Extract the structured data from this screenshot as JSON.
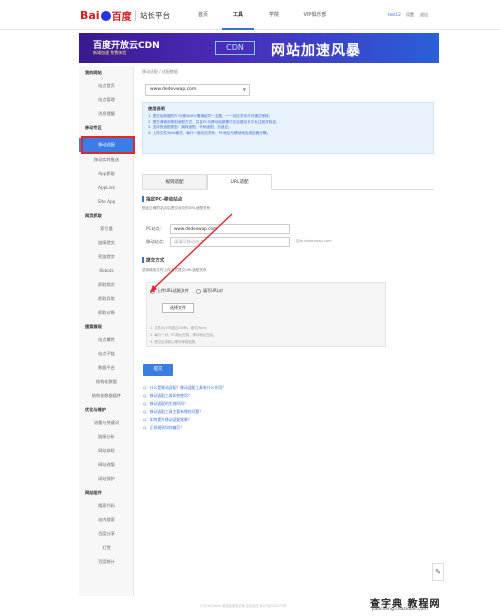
{
  "header": {
    "logo_bai": "Bai",
    "logo_du": "百度",
    "site_name": "站长平台",
    "nav": [
      "首页",
      "工具",
      "学院",
      "VIP俱乐部"
    ],
    "active_nav": "工具",
    "user_name": "test12",
    "settings": "设置",
    "logout": "退出"
  },
  "banner": {
    "title": "百度开放云CDN",
    "subtitle": "新域加速  免费体验",
    "badge": "CDN",
    "headline": "网站加速风暴"
  },
  "sidebar": {
    "groups": [
      {
        "title": "我的网站",
        "items": [
          "站点首页",
          "站点管理",
          "消息提醒"
        ]
      },
      {
        "title": "移动专区",
        "items": [
          "移动适配",
          "移动实时推送",
          "App抓取",
          "AppLink",
          "Site App"
        ]
      },
      {
        "title": "网页抓取",
        "items": [
          "索引量",
          "链接提交",
          "死链提交",
          "Robots",
          "抓取频次",
          "抓取异常",
          "抓取诊断"
        ]
      },
      {
        "title": "搜索展现",
        "items": [
          "站点属性",
          "站点子链",
          "数据平台",
          "结构化数据",
          "结构化数据插件"
        ]
      },
      {
        "title": "优化与维护",
        "items": [
          "流量与关键词",
          "链接分析",
          "网站体检",
          "网站改版",
          "闭站保护"
        ]
      },
      {
        "title": "网站组件",
        "items": [
          "搜索代码",
          "站内搜索",
          "百度分享",
          "打赏",
          "百度统计"
        ]
      }
    ],
    "active_item": "移动适配"
  },
  "main": {
    "breadcrumb": "移动适配 / 适配数据",
    "domain": "www.dedevwap.com",
    "notice": {
      "title": "使用说明",
      "lines": [
        "1. 提交后新增的PC与移动URL需满足同一主题，一一对应关系才可通过审核；",
        "2. 提交请使用规则适配方式，并且PC与移动站都需已在百度站长平台注册并验证；",
        "3. 支持的适配类型：跳转适配、代码适配、自适应；",
        "4. 上传文件为txt格式，每行一组对应关系，PC地址与移动地址用空格分隔；"
      ]
    },
    "tabs": [
      "规则适配",
      "URL适配"
    ],
    "active_tab": "URL适配",
    "section1_title": "指定PC-移动站点",
    "section1_desc": "指定正确的站点后提交对应的URL适配关系",
    "pc_label": "PC站点：",
    "pc_value": "www.dedevwap.com",
    "mobile_label": "移动站点：",
    "mobile_placeholder": "请填写移动站点",
    "mobile_hint": "如m.dedevwap.com",
    "section2_title": "提交方式",
    "section2_desc": "选择使用文件上传方式提交URL适配关系",
    "radio_upload": "上传URL适配文件",
    "radio_manual": "填写URL对",
    "file_button": "选择文件",
    "notes": [
      "1. 文件大小不超过10MB，格式为txt；",
      "2. 每行一对，PC地址在前，移动地址在后；",
      "3. 提交后请耐心等待审核结果。"
    ],
    "submit": "提交",
    "faq": [
      "Q：什么是移动适配？移动适配工具有什么作用？",
      "Q：移动适配工具如何使用？",
      "Q：移动适配的生效时间？",
      "Q：移动适配工具主要有哪些问题？",
      "Q：如何提升移动适配效果？",
      "Q：正则规则如何编写？"
    ]
  },
  "footer": "©2016 Baidu 使用百度前必读 意见反馈 京ICP证030173号",
  "watermark": {
    "main": "查字典 教程网",
    "sub": "jiaocheng.chazidian.com"
  },
  "colors": {
    "accent": "#3a7de3",
    "highlight_box": "#e0282a",
    "banner_start": "#3a1a8f",
    "banner_end": "#2b5fd9"
  }
}
